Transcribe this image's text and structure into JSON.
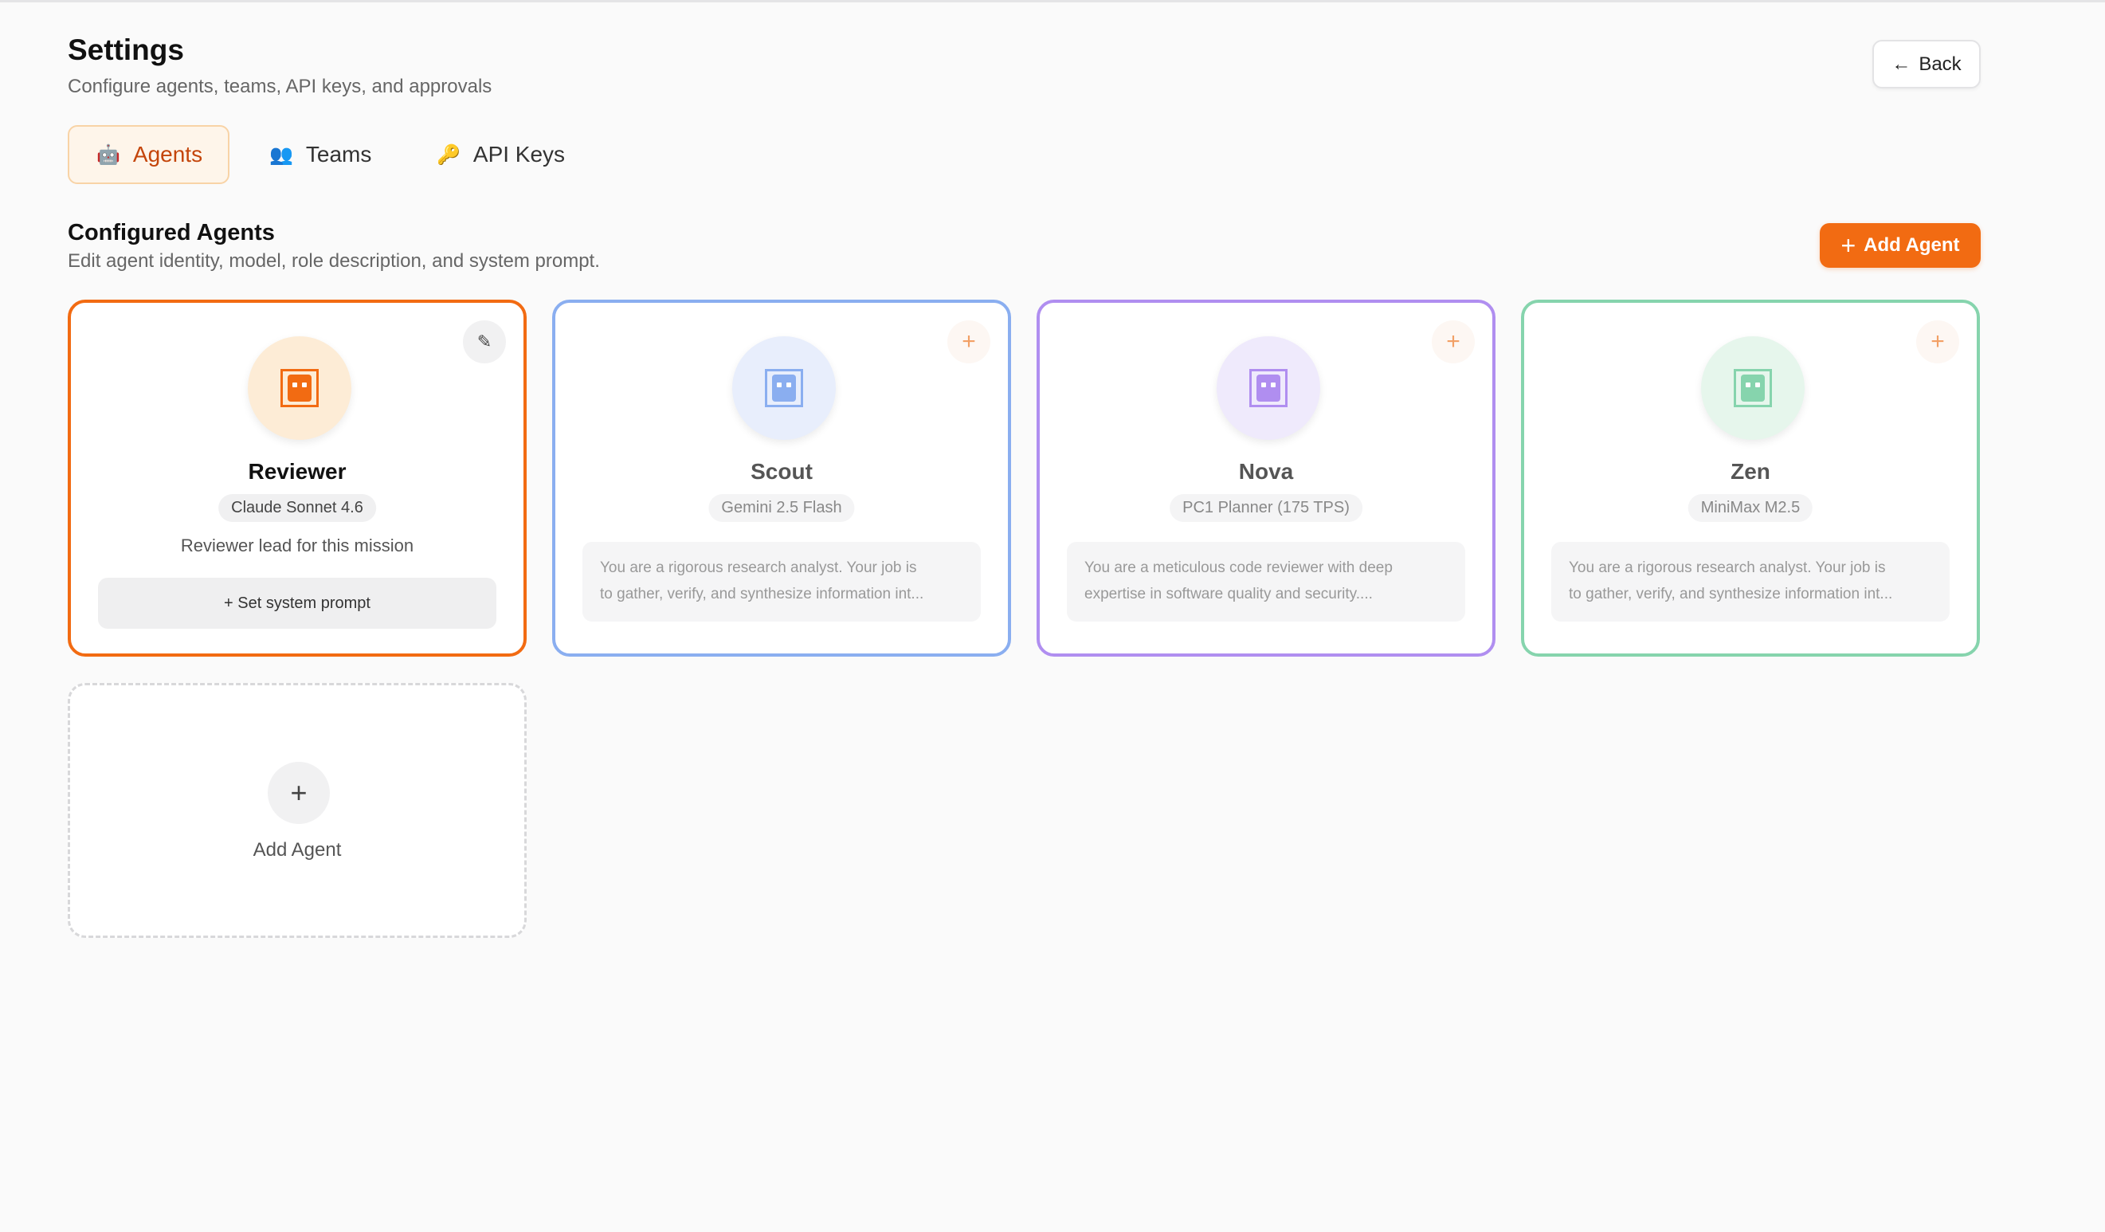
{
  "header": {
    "title": "Settings",
    "subtitle": "Configure agents, teams, API keys, and approvals",
    "back_label": "Back"
  },
  "tabs": [
    {
      "label": "Agents",
      "icon": "robot-icon",
      "active": true
    },
    {
      "label": "Teams",
      "icon": "people-icon",
      "active": false
    },
    {
      "label": "API Keys",
      "icon": "key-icon",
      "active": false
    }
  ],
  "section": {
    "title": "Configured Agents",
    "description": "Edit agent identity, model, role description, and system prompt.",
    "add_button_label": "Add Agent"
  },
  "agents": [
    {
      "name": "Reviewer",
      "model": "Claude Sonnet 4.6",
      "role": "Reviewer lead for this mission",
      "prompt_action": "+ Set system prompt",
      "color": "#f26b12",
      "avatar_bg": "#fdecd6"
    },
    {
      "name": "Scout",
      "model": "Gemini 2.5 Flash",
      "prompt_line1": "You are a rigorous research analyst. Your job is",
      "prompt_line2": "to gather, verify, and synthesize information int...",
      "color": "#8aaef0",
      "avatar_bg": "#e8eefc"
    },
    {
      "name": "Nova",
      "model": "PC1 Planner (175 TPS)",
      "prompt_line1": "You are a meticulous code reviewer with deep",
      "prompt_line2": "expertise in software quality and security....",
      "color": "#b08ef0",
      "avatar_bg": "#efeafc"
    },
    {
      "name": "Zen",
      "model": "MiniMax M2.5",
      "prompt_line1": "You are a rigorous research analyst. Your job is",
      "prompt_line2": "to gather, verify, and synthesize information int...",
      "color": "#86d4ad",
      "avatar_bg": "#e6f6ec"
    }
  ],
  "add_card": {
    "label": "Add Agent"
  },
  "colors": {
    "accent": "#f26b12"
  }
}
